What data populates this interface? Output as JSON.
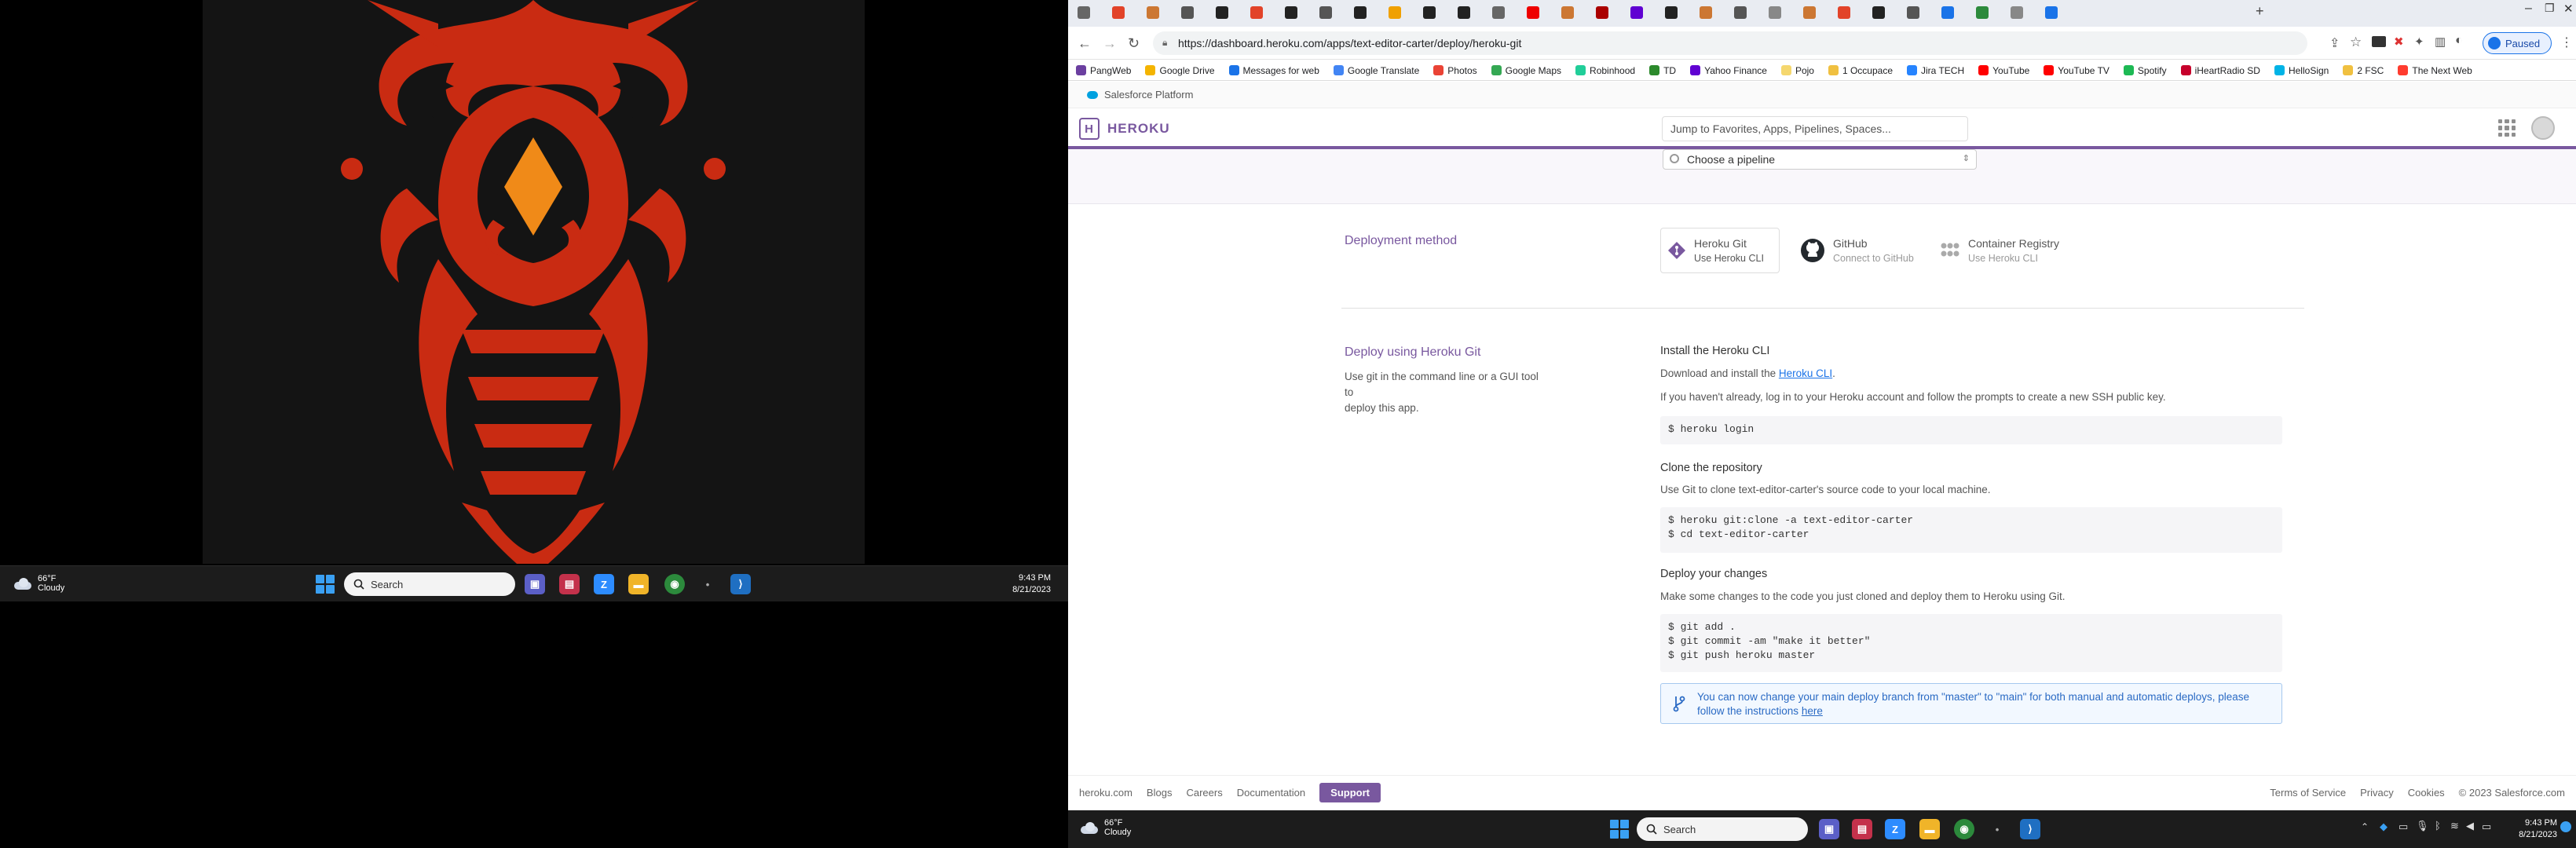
{
  "left_taskbar": {
    "weather_temp": "66°F",
    "weather_desc": "Cloudy",
    "search_placeholder": "Search",
    "time": "9:43 PM",
    "date": "8/21/2023"
  },
  "browser": {
    "url": "https://dashboard.heroku.com/apps/text-editor-carter/deploy/heroku-git",
    "paused_label": "Paused",
    "bookmarks": [
      {
        "label": "PangWeb",
        "color": "#6b3fa0"
      },
      {
        "label": "Google Drive",
        "color": "#f4b400"
      },
      {
        "label": "Messages for web",
        "color": "#1a73e8"
      },
      {
        "label": "Google Translate",
        "color": "#4285f4"
      },
      {
        "label": "Photos",
        "color": "#ea4335"
      },
      {
        "label": "Google Maps",
        "color": "#34a853"
      },
      {
        "label": "Robinhood",
        "color": "#21ce99"
      },
      {
        "label": "TD",
        "color": "#2c8a2c"
      },
      {
        "label": "Yahoo Finance",
        "color": "#6001d2"
      },
      {
        "label": "Pojo",
        "color": "#f5d76e"
      },
      {
        "label": "1 Occupace",
        "color": "#f0c040"
      },
      {
        "label": "Jira TECH",
        "color": "#2684ff"
      },
      {
        "label": "YouTube",
        "color": "#ff0000"
      },
      {
        "label": "YouTube TV",
        "color": "#ff0000"
      },
      {
        "label": "Spotify",
        "color": "#1db954"
      },
      {
        "label": "iHeartRadio SD",
        "color": "#c6002b"
      },
      {
        "label": "HelloSign",
        "color": "#00b3e6"
      },
      {
        "label": "2 FSC",
        "color": "#f0c040"
      },
      {
        "label": "The Next Web",
        "color": "#ff3c2f"
      }
    ]
  },
  "salesforce_bar": {
    "label": "Salesforce Platform"
  },
  "heroku": {
    "logo_text": "HEROKU",
    "jump_placeholder": "Jump to Favorites, Apps, Pipelines, Spaces...",
    "pipeline_select": "Choose a pipeline",
    "deployment_method_title": "Deployment method",
    "methods": [
      {
        "title": "Heroku Git",
        "sub": "Use Heroku CLI"
      },
      {
        "title": "GitHub",
        "sub": "Connect to GitHub"
      },
      {
        "title": "Container Registry",
        "sub": "Use Heroku CLI"
      }
    ],
    "deploy_title": "Deploy using Heroku Git",
    "deploy_desc_1": "Use git in the command line or a GUI tool to",
    "deploy_desc_2": "deploy this app.",
    "install_title": "Install the Heroku CLI",
    "install_text": "Download and install the",
    "install_link": "Heroku CLI",
    "login_text": "If you haven't already, log in to your Heroku account and follow the prompts to create a new SSH public key.",
    "login_code": "$ heroku login",
    "clone_title": "Clone the repository",
    "clone_text": "Use Git to clone text-editor-carter's source code to your local machine.",
    "clone_code": "$ heroku git:clone -a text-editor-carter\n$ cd text-editor-carter",
    "changes_title": "Deploy your changes",
    "changes_text": "Make some changes to the code you just cloned and deploy them to Heroku using Git.",
    "changes_code": "$ git add .\n$ git commit -am \"make it better\"\n$ git push heroku master",
    "notice_line1": "You can now change your main deploy branch from \"master\" to \"main\" for both manual and automatic deploys, please",
    "notice_line2": "follow the instructions",
    "notice_link": "here"
  },
  "footer": {
    "links": [
      "heroku.com",
      "Blogs",
      "Careers",
      "Documentation"
    ],
    "support": "Support",
    "right_links": [
      "Terms of Service",
      "Privacy",
      "Cookies",
      "© 2023 Salesforce.com"
    ]
  },
  "right_taskbar": {
    "weather_temp": "66°F",
    "weather_desc": "Cloudy",
    "search_placeholder": "Search",
    "time": "9:43 PM",
    "date": "8/21/2023"
  }
}
